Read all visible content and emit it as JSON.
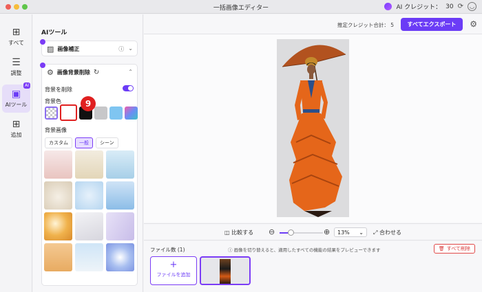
{
  "window": {
    "title": "一括画像エディター"
  },
  "credits": {
    "label": "AI クレジット：",
    "value": "30"
  },
  "rail": {
    "items": [
      {
        "label": "すべて",
        "icon": "grid-icon"
      },
      {
        "label": "調整",
        "icon": "sliders-icon"
      },
      {
        "label": "AIツール",
        "icon": "ai-icon",
        "badge": "AI",
        "active": true
      },
      {
        "label": "追加",
        "icon": "plus-square-icon"
      }
    ]
  },
  "panel": {
    "title": "AIツール",
    "enhance": {
      "label": "画像補正"
    },
    "bg_remove": {
      "label": "画像背景削除",
      "toggle_label": "背景を削除",
      "toggle_on": true,
      "bg_color_label": "背景色",
      "swatches": [
        "transparent",
        "#ffffff",
        "#111111",
        "#c7c7c9",
        "#7fc5f1",
        "gradient"
      ],
      "selected_swatch": "#ffffff",
      "step_badge": "9",
      "bg_image_label": "背景画像",
      "tabs": [
        "カスタム",
        "一般",
        "シーン"
      ],
      "active_tab": "一般"
    }
  },
  "topbar": {
    "estimate": "推定クレジット合計： 5",
    "export": "すべてエクスポート"
  },
  "zoom": {
    "compare": "比較する",
    "value": "13%",
    "level": 0.25,
    "fit": "合わせる"
  },
  "files": {
    "count": "ファイル数 (1)",
    "note": "画像を切り替えると、適用したすべての機能の結果をプレビューできます",
    "delete_all": "すべて削除",
    "add": "ファイルを追加"
  },
  "colors": {
    "accent": "#6b3cf6",
    "danger": "#e02020"
  }
}
